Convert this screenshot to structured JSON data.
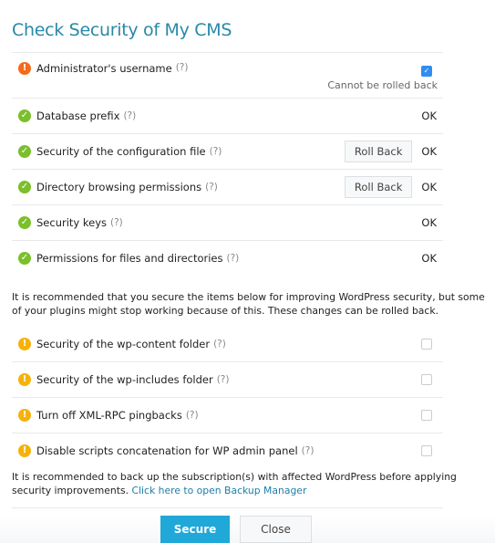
{
  "title": "Check Security of My CMS",
  "help_marker": "(?)",
  "critical_items": [
    {
      "label": "Administrator's username",
      "status": "error",
      "checked": true,
      "note": "Cannot be rolled back"
    },
    {
      "label": "Database prefix",
      "status": "ok",
      "result": "OK"
    },
    {
      "label": "Security of the configuration file",
      "status": "ok",
      "result": "OK",
      "action": "Roll Back"
    },
    {
      "label": "Directory browsing permissions",
      "status": "ok",
      "result": "OK",
      "action": "Roll Back"
    },
    {
      "label": "Security keys",
      "status": "ok",
      "result": "OK"
    },
    {
      "label": "Permissions for files and directories",
      "status": "ok",
      "result": "OK"
    }
  ],
  "recommendation_text": "It is recommended that you secure the items below for improving WordPress security, but some of your plugins might stop working because of this. These changes can be rolled back.",
  "optional_items": [
    {
      "label": "Security of the wp-content folder",
      "status": "warning",
      "checked": false
    },
    {
      "label": "Security of the wp-includes folder",
      "status": "warning",
      "checked": false
    },
    {
      "label": "Turn off XML-RPC pingbacks",
      "status": "warning",
      "checked": false
    },
    {
      "label": "Disable scripts concatenation for WP admin panel",
      "status": "warning",
      "checked": false
    }
  ],
  "backup_text": "It is recommended to back up the subscription(s) with affected WordPress before applying security improvements.",
  "backup_link": "Click here to open Backup Manager",
  "buttons": {
    "secure": "Secure",
    "close": "Close"
  },
  "colors": {
    "accent": "#2a88a8",
    "primary_button": "#1fa8d8",
    "ok": "#7bbf2b",
    "error": "#f26a1b",
    "warning": "#f5b20a",
    "checkbox": "#2f8ef0"
  }
}
